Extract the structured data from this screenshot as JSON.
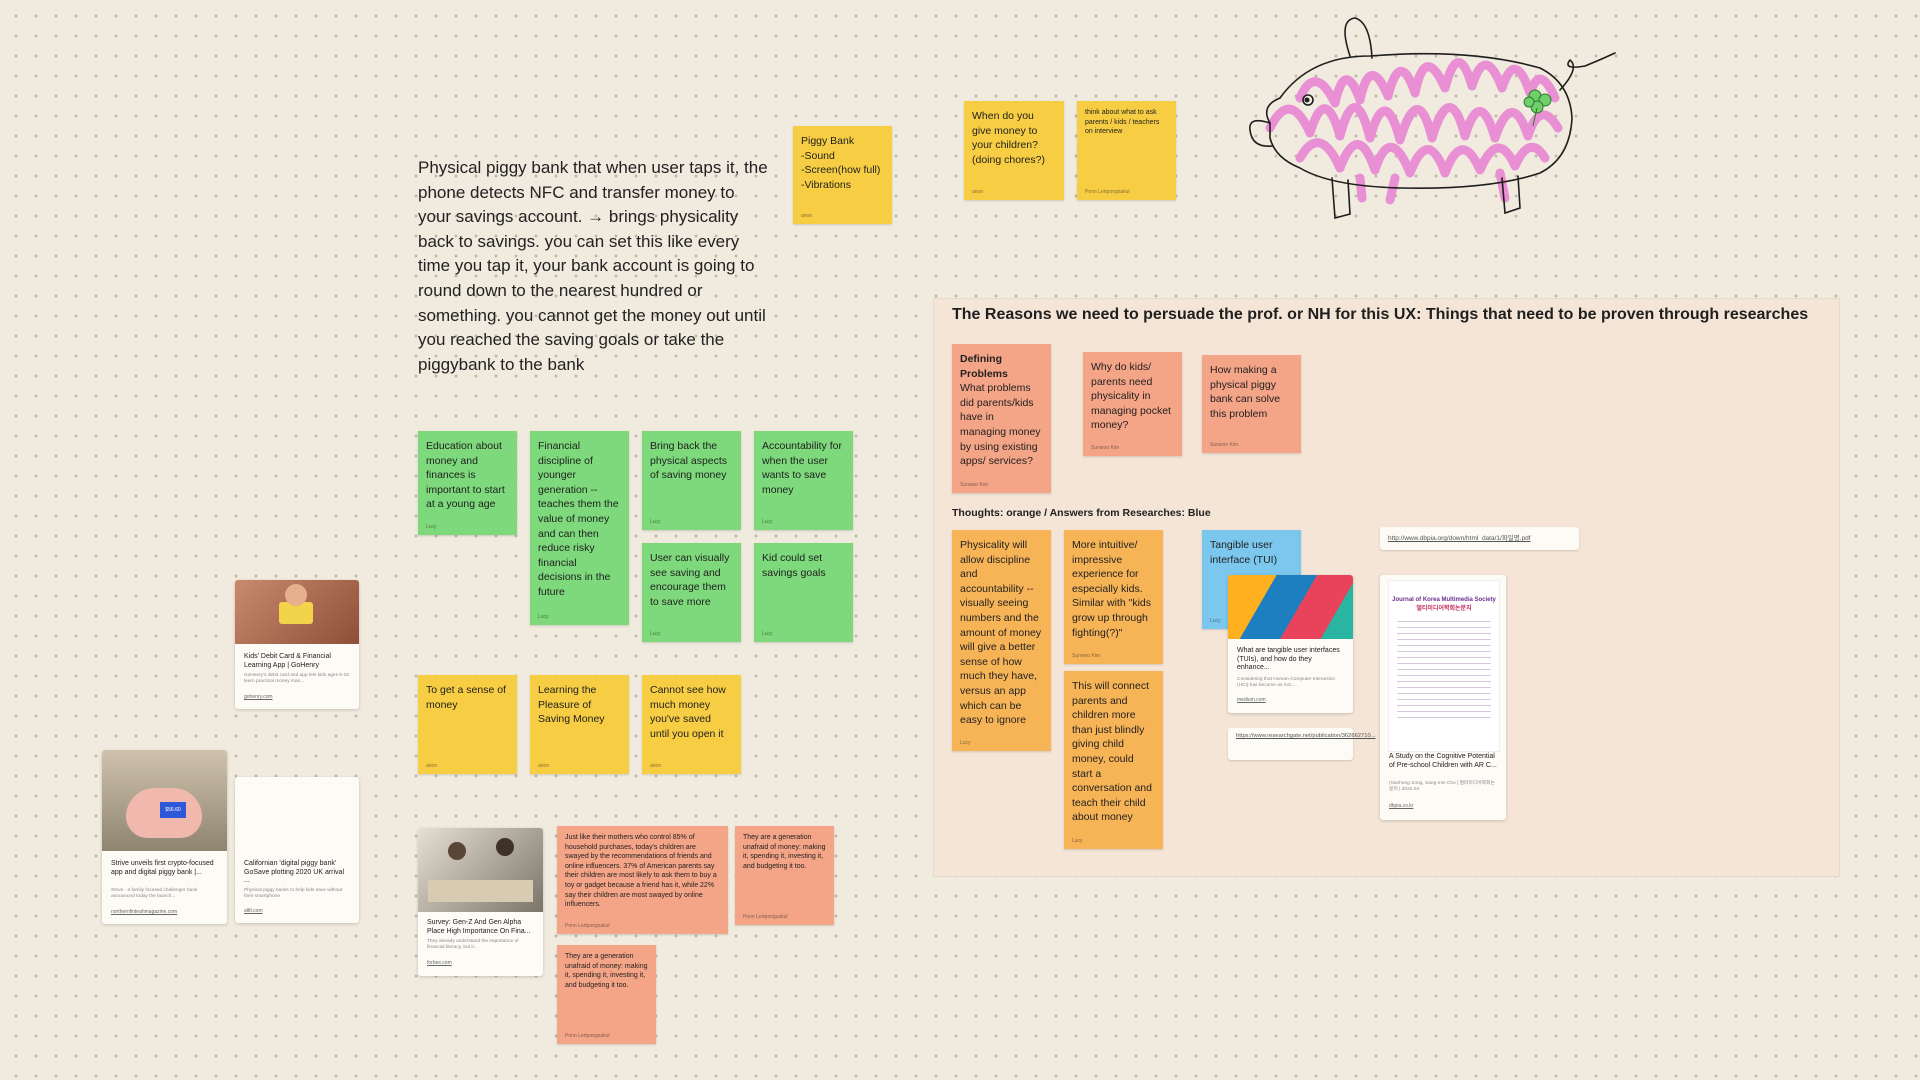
{
  "main_text": "Physical piggy bank that when user taps it, the phone detects NFC and transfer money to your savings account. → brings physicality back to savings. you can set this like every time you tap it, your bank account is going to round down to the nearest hundred or something. you cannot get the money out until you reached the saving goals or take the piggybank to the bank",
  "top_notes": {
    "piggy_bank": {
      "text": "Piggy Bank\n-Sound\n-Screen(how full)\n-Vibrations",
      "author": "anon"
    },
    "when_give": {
      "text": "When do you give money to your children? (doing chores?)",
      "author": "anon"
    },
    "think_about": {
      "text": "think about what to ask parents / kids / teachers on interview",
      "author": "Ponn Lertpongsakul"
    }
  },
  "green_notes": [
    {
      "text": "Education about money and finances is important to start at a young age",
      "author": "Lucy"
    },
    {
      "text": "Financial discipline of younger generation -- teaches them the value of money and can then reduce risky financial decisions in the future",
      "author": "Lucy"
    },
    {
      "text": "Bring back the physical aspects of saving money",
      "author": "Lucy"
    },
    {
      "text": "Accountability for when the user wants to save money",
      "author": "Lucy"
    },
    {
      "text": "User can visually see saving and encourage them to save more",
      "author": "Lucy"
    },
    {
      "text": "Kid could set savings goals",
      "author": "Lucy"
    }
  ],
  "yellow_notes": [
    {
      "text": "To get a sense of money",
      "author": "anon"
    },
    {
      "text": "Learning the Pleasure of Saving Money",
      "author": "anon"
    },
    {
      "text": "Cannot see how much money you've saved until you open it",
      "author": "anon"
    }
  ],
  "bottom_notes": [
    {
      "text": "Just like their mothers who control 85% of household purchases, today's children are swayed by the recommendations of friends and online influencers. 37% of American parents say their children are most likely to ask them to buy a toy or gadget because a friend has it, while 22% say their children are most swayed by online influencers.",
      "author": "Ponn Lertpongsakul"
    },
    {
      "text": "They are a generation unafraid of money: making it, spending it, investing it, and budgeting it too.",
      "author": "Ponn Lertpongsakul"
    },
    {
      "text": "They are a generation unafraid of money: making it, spending it, investing it, and budgeting it too.",
      "author": "Ponn Lertpongsakul"
    }
  ],
  "frame": {
    "title": "The Reasons we need to persuade the prof. or NH for this UX: Things that need to be proven through researches",
    "subtitle": "Thoughts: orange / Answers from Researches: Blue",
    "defining": {
      "heading": "Defining Problems",
      "text": "What problems did parents/kids have in managing money by using existing apps/ services?",
      "author": "Sunwoo Kim"
    },
    "why_kids": {
      "text": "Why do kids/ parents need physicality in managing pocket money?",
      "author": "Sunwoo Kim"
    },
    "how_making": {
      "text": "How making a physical piggy bank can solve this problem",
      "author": "Sunwoo Kim"
    },
    "physicality": {
      "text": "Physicality will allow discipline and accountability -- visually seeing numbers and the amount of money will give a better sense of how much they have, versus an app which can be easy to ignore",
      "author": "Lucy"
    },
    "intuitive": {
      "text": "More intuitive/ impressive experience for especially kids. Similar with \"kids grow up through fighting(?)\"",
      "author": "Sunwoo Kim"
    },
    "connect": {
      "text": "This will connect parents and children more than just blindly giving child money, could start a conversation and teach their child about money",
      "author": "Lucy"
    },
    "tui": {
      "text": "Tangible user interface (TUI)",
      "author": "Lucy"
    },
    "tui_card": {
      "title": "What are tangible user interfaces (TUIs), and how do they enhance...",
      "desc": "Considering that Human-Computer Interaction (HCI) has become an incr...",
      "url": "medium.com"
    },
    "rg_link": "https://www.researchgate.net/publication/362662710...",
    "pdf_link": "http://www.dbpia.org/down/html_data/1/파일명.pdf",
    "journal": {
      "title": "Journal of Korea Multimedia Society",
      "subtitle": "멀티미디어학회논문지",
      "caption": "A Study on the Cognitive Potential of Pre-school Children with AR C...",
      "desc": "(Sanhong Song, Sang-min Cho | 멀티미디어학회논문지 | 2022.04",
      "url": "dbpia.co.kr"
    }
  },
  "cards": {
    "gohenry": {
      "title": "Kids' Debit Card & Financial Learning App | GoHenry",
      "desc": "GoHenry's debit card and app lets kids ages 6-18 learn practical money man...",
      "url": "gohenry.com"
    },
    "strive": {
      "title": "Strive unveils first crypto-focused app and digital piggy bank |...",
      "desc": "Strive - a family focused challenger bank announced today the launch...",
      "url": "northernfinteahmagazine.com",
      "screen": "$56.60"
    },
    "californian": {
      "title": "Californian 'digital piggy bank' GoSave plotting 2020 UK arrival ...",
      "desc": "Physical piggy banks to help kids save without their smartphone",
      "url": "altfi.com"
    },
    "survey": {
      "title": "Survey: Gen-Z And Gen Alpha Place High Importance On Fina...",
      "desc": "They already understand the importance of financial literacy, but it...",
      "url": "forbes.com"
    }
  }
}
